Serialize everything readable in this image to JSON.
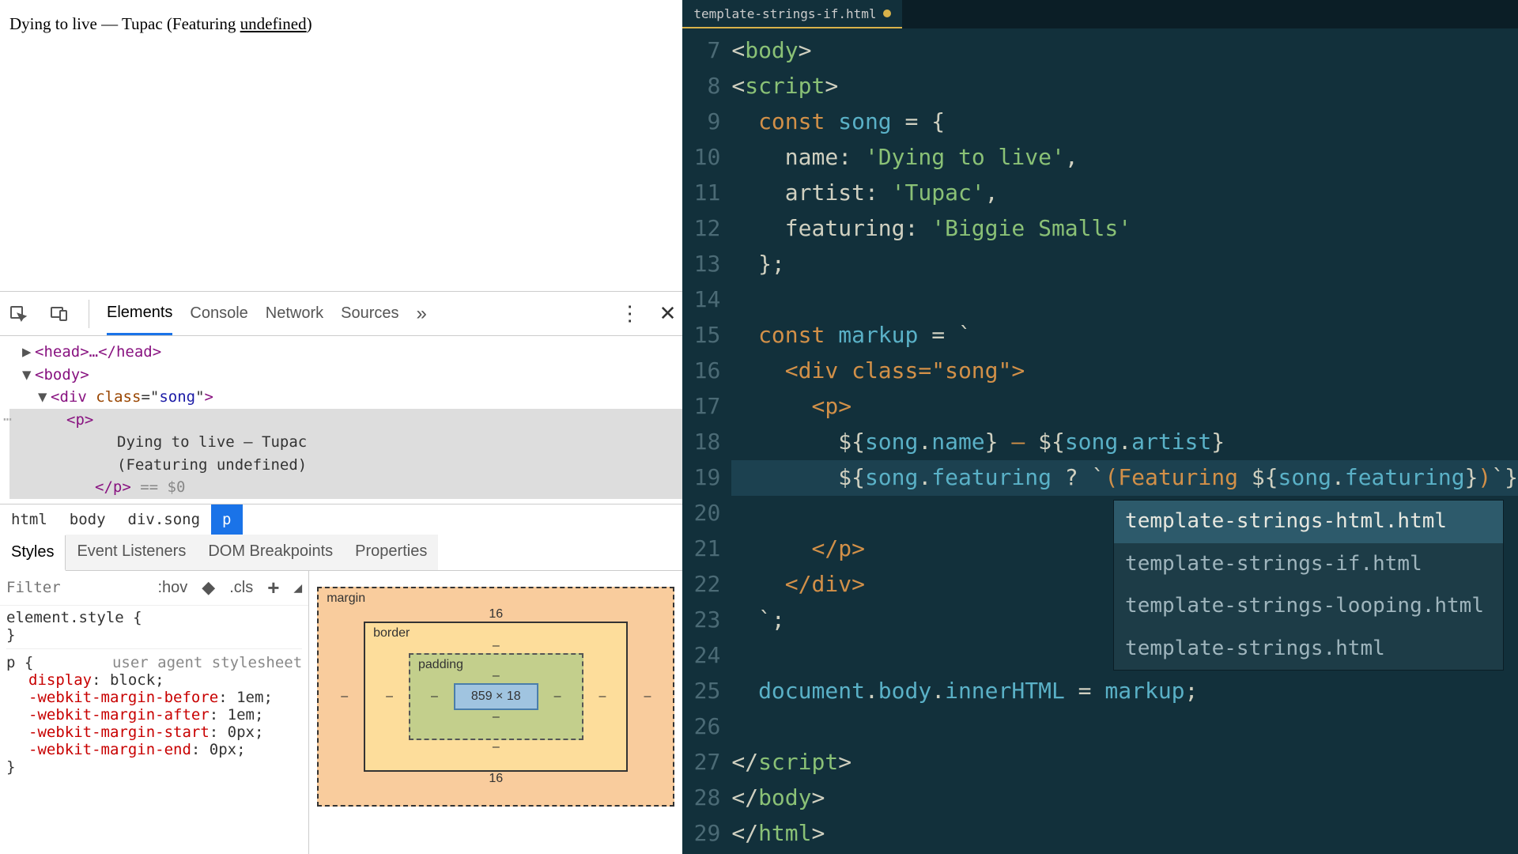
{
  "page": {
    "text_before": "Dying to live — Tupac (Featuring ",
    "underlined": "undefined",
    "text_after": ")"
  },
  "devtools": {
    "tabs": [
      "Elements",
      "Console",
      "Network",
      "Sources"
    ],
    "active_tab": "Elements",
    "tree": {
      "head": "<head>…</head>",
      "body_open": "<body>",
      "div_open_tag": "div",
      "div_attr_name": "class",
      "div_attr_val": "song",
      "p_open": "<p>",
      "text1": "Dying to live — Tupac",
      "text2": "(Featuring undefined)",
      "p_close": "</p>",
      "dollar0": " == $0"
    },
    "breadcrumbs": [
      "html",
      "body",
      "div.song",
      "p"
    ],
    "active_breadcrumb": "p",
    "styles_tabs": [
      "Styles",
      "Event Listeners",
      "DOM Breakpoints",
      "Properties"
    ],
    "active_styles_tab": "Styles",
    "filter_placeholder": "Filter",
    "tools": {
      "hov": ":hov",
      "cls": ".cls"
    },
    "element_style_selector": "element.style",
    "ua_label": "user agent stylesheet",
    "p_selector": "p",
    "declarations": [
      {
        "prop": "display",
        "val": "block"
      },
      {
        "prop": "-webkit-margin-before",
        "val": "1em"
      },
      {
        "prop": "-webkit-margin-after",
        "val": "1em"
      },
      {
        "prop": "-webkit-margin-start",
        "val": "0px"
      },
      {
        "prop": "-webkit-margin-end",
        "val": "0px"
      }
    ],
    "box_model": {
      "margin": "margin",
      "border": "border",
      "padding": "padding",
      "margin_top": "16",
      "margin_bottom": "16",
      "margin_left": "–",
      "margin_right": "–",
      "border_all": "–",
      "padding_all": "–",
      "content": "859 × 18"
    }
  },
  "editor": {
    "tab_name": "template-strings-if.html",
    "line_numbers": [
      "7",
      "8",
      "9",
      "10",
      "11",
      "12",
      "13",
      "14",
      "15",
      "16",
      "17",
      "18",
      "19",
      "20",
      "21",
      "22",
      "23",
      "24",
      "25",
      "26",
      "27",
      "28",
      "29"
    ],
    "lines": {
      "l7": {
        "indent": "",
        "tokens": [
          {
            "t": "<",
            "c": "tok-punc"
          },
          {
            "t": "body",
            "c": "tok-tag"
          },
          {
            "t": ">",
            "c": "tok-punc"
          }
        ]
      },
      "l8": {
        "indent": "",
        "tokens": [
          {
            "t": "<",
            "c": "tok-punc"
          },
          {
            "t": "script",
            "c": "tok-tag"
          },
          {
            "t": ">",
            "c": "tok-punc"
          }
        ]
      },
      "l9": {
        "indent": "  ",
        "tokens": [
          {
            "t": "const ",
            "c": "tok-kw"
          },
          {
            "t": "song",
            "c": "tok-var"
          },
          {
            "t": " = {",
            "c": "tok-punc"
          }
        ]
      },
      "l10": {
        "indent": "    ",
        "tokens": [
          {
            "t": "name: ",
            "c": "tok-prop"
          },
          {
            "t": "'Dying to live'",
            "c": "tok-str"
          },
          {
            "t": ",",
            "c": "tok-punc"
          }
        ]
      },
      "l11": {
        "indent": "    ",
        "tokens": [
          {
            "t": "artist: ",
            "c": "tok-prop"
          },
          {
            "t": "'Tupac'",
            "c": "tok-str"
          },
          {
            "t": ",",
            "c": "tok-punc"
          }
        ]
      },
      "l12": {
        "indent": "    ",
        "tokens": [
          {
            "t": "featuring: ",
            "c": "tok-prop"
          },
          {
            "t": "'Biggie Smalls'",
            "c": "tok-str"
          }
        ]
      },
      "l13": {
        "indent": "  ",
        "tokens": [
          {
            "t": "};",
            "c": "tok-punc"
          }
        ]
      },
      "l14": {
        "indent": "",
        "tokens": []
      },
      "l15": {
        "indent": "  ",
        "tokens": [
          {
            "t": "const ",
            "c": "tok-kw"
          },
          {
            "t": "markup",
            "c": "tok-var"
          },
          {
            "t": " = `",
            "c": "tok-punc"
          }
        ]
      },
      "l16": {
        "indent": "    ",
        "tokens": [
          {
            "t": "<div class=\"song\">",
            "c": "tok-tmpl"
          }
        ]
      },
      "l17": {
        "indent": "      ",
        "tokens": [
          {
            "t": "<p>",
            "c": "tok-tmpl"
          }
        ]
      },
      "l18": {
        "indent": "        ",
        "tokens": [
          {
            "t": "${",
            "c": "tok-punc"
          },
          {
            "t": "song",
            "c": "tok-embed"
          },
          {
            "t": ".",
            "c": "tok-punc"
          },
          {
            "t": "name",
            "c": "tok-embed"
          },
          {
            "t": "}",
            "c": "tok-punc"
          },
          {
            "t": " — ",
            "c": "tok-tmpl"
          },
          {
            "t": "${",
            "c": "tok-punc"
          },
          {
            "t": "song",
            "c": "tok-embed"
          },
          {
            "t": ".",
            "c": "tok-punc"
          },
          {
            "t": "artist",
            "c": "tok-embed"
          },
          {
            "t": "}",
            "c": "tok-punc"
          }
        ]
      },
      "l19": {
        "indent": "        ",
        "tokens": [
          {
            "t": "${",
            "c": "tok-punc"
          },
          {
            "t": "song",
            "c": "tok-embed"
          },
          {
            "t": ".",
            "c": "tok-punc"
          },
          {
            "t": "featuring",
            "c": "tok-embed"
          },
          {
            "t": " ? `",
            "c": "tok-punc"
          },
          {
            "t": "(Featuring ",
            "c": "tok-tmpl"
          },
          {
            "t": "${",
            "c": "tok-punc"
          },
          {
            "t": "song",
            "c": "tok-embed"
          },
          {
            "t": ".",
            "c": "tok-punc"
          },
          {
            "t": "featuring",
            "c": "tok-embed"
          },
          {
            "t": "}",
            "c": "tok-punc"
          },
          {
            "t": ")",
            "c": "tok-tmpl"
          },
          {
            "t": "`}",
            "c": "tok-punc"
          }
        ]
      },
      "l20": {
        "indent": "",
        "tokens": []
      },
      "l21": {
        "indent": "      ",
        "tokens": [
          {
            "t": "</p>",
            "c": "tok-tmpl"
          }
        ]
      },
      "l22": {
        "indent": "    ",
        "tokens": [
          {
            "t": "</div>",
            "c": "tok-tmpl"
          }
        ]
      },
      "l23": {
        "indent": "  ",
        "tokens": [
          {
            "t": "`;",
            "c": "tok-punc"
          }
        ]
      },
      "l24": {
        "indent": "",
        "tokens": []
      },
      "l25": {
        "indent": "  ",
        "tokens": [
          {
            "t": "document",
            "c": "tok-var"
          },
          {
            "t": ".",
            "c": "tok-punc"
          },
          {
            "t": "body",
            "c": "tok-var"
          },
          {
            "t": ".",
            "c": "tok-punc"
          },
          {
            "t": "innerHTML",
            "c": "tok-var"
          },
          {
            "t": " = ",
            "c": "tok-op"
          },
          {
            "t": "markup",
            "c": "tok-var"
          },
          {
            "t": ";",
            "c": "tok-punc"
          }
        ]
      },
      "l26": {
        "indent": "",
        "tokens": []
      },
      "l27": {
        "indent": "",
        "tokens": [
          {
            "t": "</",
            "c": "tok-punc"
          },
          {
            "t": "script",
            "c": "tok-tag"
          },
          {
            "t": ">",
            "c": "tok-punc"
          }
        ]
      },
      "l28": {
        "indent": "",
        "tokens": [
          {
            "t": "</",
            "c": "tok-punc"
          },
          {
            "t": "body",
            "c": "tok-tag"
          },
          {
            "t": ">",
            "c": "tok-punc"
          }
        ]
      },
      "l29": {
        "indent": "",
        "tokens": [
          {
            "t": "</",
            "c": "tok-punc"
          },
          {
            "t": "html",
            "c": "tok-tag"
          },
          {
            "t": ">",
            "c": "tok-punc"
          }
        ]
      }
    },
    "highlighted_line": "l19",
    "autocomplete": [
      "template-strings-html.html",
      "template-strings-if.html",
      "template-strings-looping.html",
      "template-strings.html"
    ],
    "autocomplete_selected": 0
  }
}
